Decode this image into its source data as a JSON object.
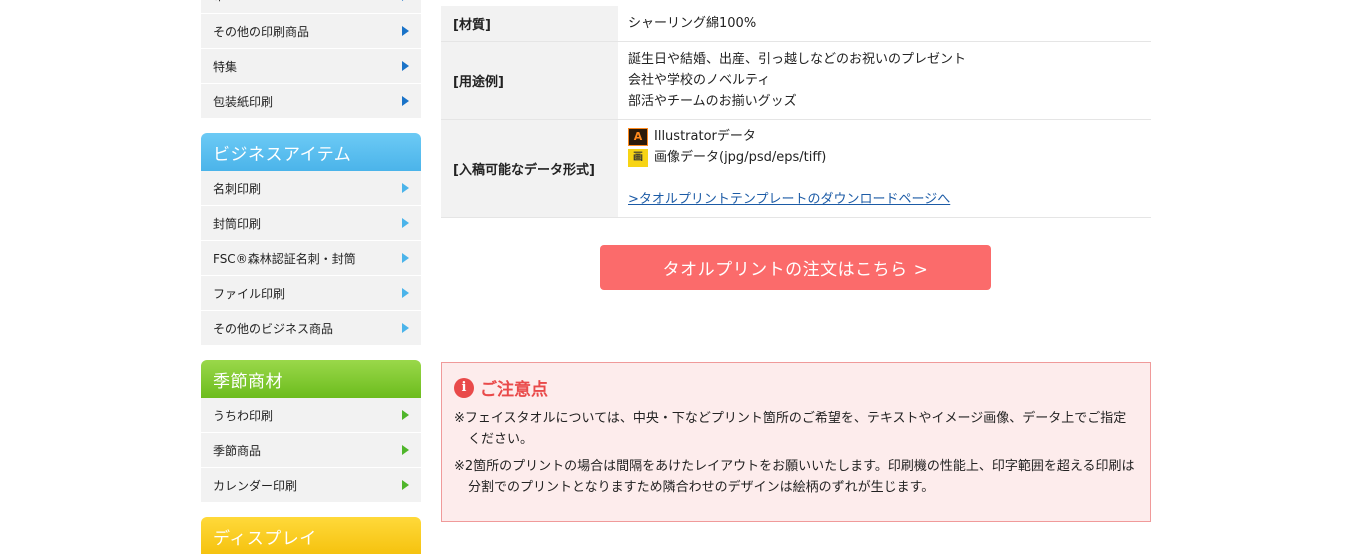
{
  "sidebar": {
    "print_menu": [
      {
        "label": "布"
      },
      {
        "label": "その他の印刷商品"
      },
      {
        "label": "特集"
      },
      {
        "label": "包装紙印刷"
      }
    ],
    "business": {
      "title": "ビジネスアイテム",
      "items": [
        {
          "label": "名刺印刷"
        },
        {
          "label": "封筒印刷"
        },
        {
          "label": "FSC®森林認証名刺・封筒"
        },
        {
          "label": "ファイル印刷"
        },
        {
          "label": "その他のビジネス商品"
        }
      ]
    },
    "seasonal": {
      "title": "季節商材",
      "items": [
        {
          "label": "うちわ印刷"
        },
        {
          "label": "季節商品"
        },
        {
          "label": "カレンダー印刷"
        }
      ]
    },
    "display": {
      "title": "ディスプレイ"
    }
  },
  "spec": {
    "material_label": "[材質]",
    "material_value": "シャーリング綿100%",
    "usage_label": "[用途例]",
    "usage_lines": [
      "誕生日や結婚、出産、引っ越しなどのお祝いのプレゼント",
      "会社や学校のノベルティ",
      "部活やチームのお揃いグッズ"
    ],
    "data_label": "[入稿可能なデータ形式]",
    "illustrator_badge": "A",
    "illustrator_text": "Illustratorデータ",
    "image_badge": "画",
    "image_text": "画像データ(jpg/psd/eps/tiff)",
    "template_link": ">タオルプリントテンプレートのダウンロードページへ"
  },
  "order_button": "タオルプリントの注文はこちら >",
  "notice": {
    "icon": "i",
    "title": "ご注意点",
    "lines": [
      "※フェイスタオルについては、中央・下などプリント箇所のご希望を、テキストやイメージ画像、データ上でご指定ください。",
      "※2箇所のプリントの場合は間隔をあけたレイアウトをお願いいたします。印刷機の性能上、印字範囲を超える印刷は分割でのプリントとなりますため隣合わせのデザインは絵柄のずれが生じます。"
    ]
  },
  "colors": {
    "order_button_bg": "#fb6b6b",
    "notice_bg": "#fdecec",
    "notice_accent": "#e94a4a",
    "business_header": "#4bb4ea",
    "seasonal_header": "#6cbc1d",
    "display_header": "#f5c20e",
    "link": "#1c5ba6"
  }
}
